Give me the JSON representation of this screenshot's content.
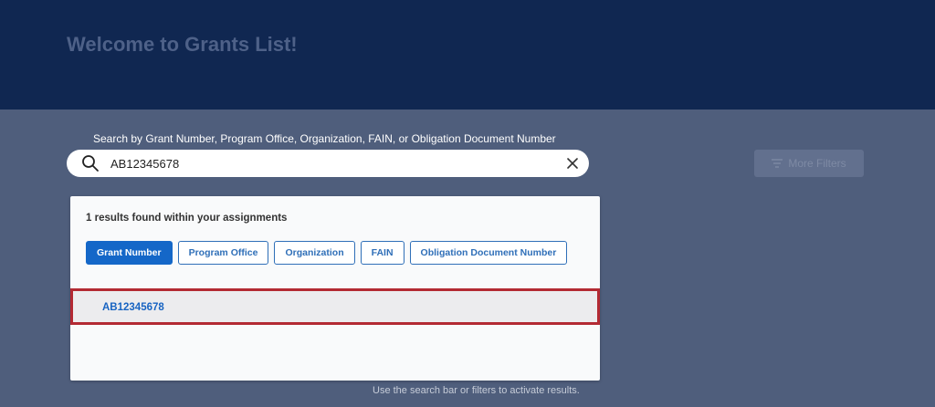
{
  "header": {
    "title": "Welcome to Grants List!"
  },
  "search": {
    "label": "Search by Grant Number, Program Office, Organization, FAIN, or Obligation Document Number",
    "value": "AB12345678",
    "icon": "search-icon",
    "clear_icon": "close-icon"
  },
  "filters": {
    "more_label": "More Filters",
    "icon": "filter-lines-icon"
  },
  "results": {
    "count_text": "1 results found within your assignments",
    "chips": [
      {
        "label": "Grant Number",
        "active": true
      },
      {
        "label": "Program Office",
        "active": false
      },
      {
        "label": "Organization",
        "active": false
      },
      {
        "label": "FAIN",
        "active": false
      },
      {
        "label": "Obligation Document Number",
        "active": false
      }
    ],
    "items": [
      {
        "label": "AB12345678"
      }
    ]
  },
  "hint": "Use the search bar or filters to activate results.",
  "colors": {
    "header_bg": "#102751",
    "overlay_bg": "#4f5e7c",
    "accent": "#1467c8",
    "highlight_border": "#b32a33"
  }
}
